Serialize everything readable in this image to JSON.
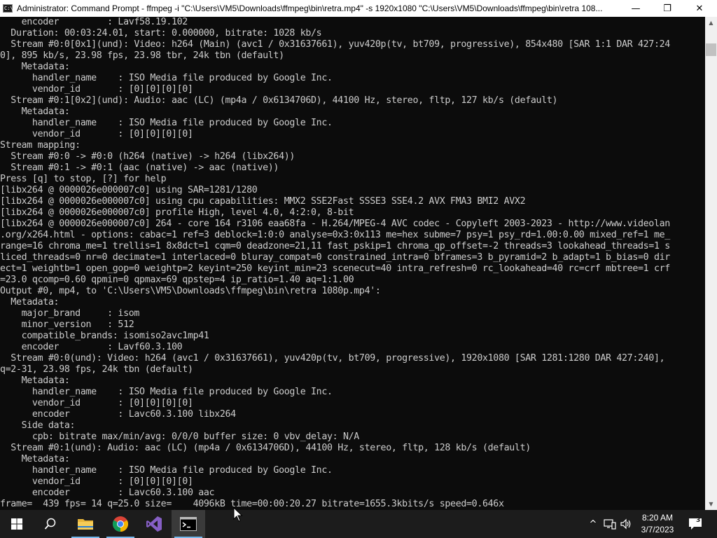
{
  "window": {
    "title": "Administrator:  Command Prompt - ffmpeg  -i \"C:\\Users\\VM5\\Downloads\\ffmpeg\\bin\\retra.mp4\" -s 1920x1080 \"C:\\Users\\VM5\\Downloads\\ffmpeg\\bin\\retra 108...",
    "icon_text": "C:\\",
    "controls": {
      "minimize": "—",
      "maximize": "❐",
      "close": "✕"
    }
  },
  "console": {
    "lines": [
      "    encoder         : Lavf58.19.102",
      "  Duration: 00:03:24.01, start: 0.000000, bitrate: 1028 kb/s",
      "  Stream #0:0[0x1](und): Video: h264 (Main) (avc1 / 0x31637661), yuv420p(tv, bt709, progressive), 854x480 [SAR 1:1 DAR 427:24",
      "0], 895 kb/s, 23.98 fps, 23.98 tbr, 24k tbn (default)",
      "    Metadata:",
      "      handler_name    : ISO Media file produced by Google Inc.",
      "      vendor_id       : [0][0][0][0]",
      "  Stream #0:1[0x2](und): Audio: aac (LC) (mp4a / 0x6134706D), 44100 Hz, stereo, fltp, 127 kb/s (default)",
      "    Metadata:",
      "      handler_name    : ISO Media file produced by Google Inc.",
      "      vendor_id       : [0][0][0][0]",
      "Stream mapping:",
      "  Stream #0:0 -> #0:0 (h264 (native) -> h264 (libx264))",
      "  Stream #0:1 -> #0:1 (aac (native) -> aac (native))",
      "Press [q] to stop, [?] for help",
      "[libx264 @ 0000026e000007c0] using SAR=1281/1280",
      "[libx264 @ 0000026e000007c0] using cpu capabilities: MMX2 SSE2Fast SSSE3 SSE4.2 AVX FMA3 BMI2 AVX2",
      "[libx264 @ 0000026e000007c0] profile High, level 4.0, 4:2:0, 8-bit",
      "[libx264 @ 0000026e000007c0] 264 - core 164 r3106 eaa68fa - H.264/MPEG-4 AVC codec - Copyleft 2003-2023 - http://www.videolan",
      ".org/x264.html - options: cabac=1 ref=3 deblock=1:0:0 analyse=0x3:0x113 me=hex subme=7 psy=1 psy_rd=1.00:0.00 mixed_ref=1 me_",
      "range=16 chroma_me=1 trellis=1 8x8dct=1 cqm=0 deadzone=21,11 fast_pskip=1 chroma_qp_offset=-2 threads=3 lookahead_threads=1 s",
      "liced_threads=0 nr=0 decimate=1 interlaced=0 bluray_compat=0 constrained_intra=0 bframes=3 b_pyramid=2 b_adapt=1 b_bias=0 dir",
      "ect=1 weightb=1 open_gop=0 weightp=2 keyint=250 keyint_min=23 scenecut=40 intra_refresh=0 rc_lookahead=40 rc=crf mbtree=1 crf",
      "=23.0 qcomp=0.60 qpmin=0 qpmax=69 qpstep=4 ip_ratio=1.40 aq=1:1.00",
      "Output #0, mp4, to 'C:\\Users\\VM5\\Downloads\\ffmpeg\\bin\\retra 1080p.mp4':",
      "  Metadata:",
      "    major_brand     : isom",
      "    minor_version   : 512",
      "    compatible_brands: isomiso2avc1mp41",
      "    encoder         : Lavf60.3.100",
      "  Stream #0:0(und): Video: h264 (avc1 / 0x31637661), yuv420p(tv, bt709, progressive), 1920x1080 [SAR 1281:1280 DAR 427:240],",
      "q=2-31, 23.98 fps, 24k tbn (default)",
      "    Metadata:",
      "      handler_name    : ISO Media file produced by Google Inc.",
      "      vendor_id       : [0][0][0][0]",
      "      encoder         : Lavc60.3.100 libx264",
      "    Side data:",
      "      cpb: bitrate max/min/avg: 0/0/0 buffer size: 0 vbv_delay: N/A",
      "  Stream #0:1(und): Audio: aac (LC) (mp4a / 0x6134706D), 44100 Hz, stereo, fltp, 128 kb/s (default)",
      "    Metadata:",
      "      handler_name    : ISO Media file produced by Google Inc.",
      "      vendor_id       : [0][0][0][0]",
      "      encoder         : Lavc60.3.100 aac",
      "frame=  439 fps= 14 q=25.0 size=    4096kB time=00:00:20.27 bitrate=1655.3kbits/s speed=0.646x"
    ]
  },
  "taskbar": {
    "items": [
      {
        "name": "start-button",
        "icon": "windows-logo-icon",
        "active": false
      },
      {
        "name": "search-button",
        "icon": "search-icon",
        "active": false
      },
      {
        "name": "file-explorer-button",
        "icon": "folder-icon",
        "active": false
      },
      {
        "name": "chrome-button",
        "icon": "chrome-icon",
        "active": false
      },
      {
        "name": "visual-studio-button",
        "icon": "visual-studio-icon",
        "active": false
      },
      {
        "name": "command-prompt-button",
        "icon": "terminal-icon",
        "active": true
      }
    ],
    "tray": {
      "chevron": "^",
      "time": "8:20 AM",
      "date": "3/7/2023",
      "notification_count": "3"
    },
    "colors": {
      "background": "#1c1c1c",
      "active_underline": "#76b9ed"
    }
  }
}
